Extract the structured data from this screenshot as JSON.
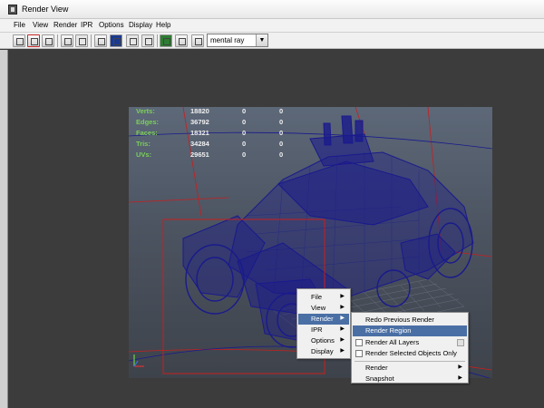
{
  "window": {
    "title": "Render View"
  },
  "menubar": {
    "items": [
      "File",
      "View",
      "Render",
      "IPR",
      "Options",
      "Display",
      "Help"
    ]
  },
  "toolbar": {
    "buttons": [
      "redo-previous-render",
      "render-region",
      "snapshot",
      "ipr-render",
      "refresh-ipr",
      "keep-image",
      "rgb-channels",
      "alpha-channel",
      "real-size",
      "display-options",
      "color-settings",
      "open-image"
    ],
    "renderer": "mental ray"
  },
  "hud": {
    "rows": [
      {
        "label": "Verts:",
        "values": [
          "18820",
          "0",
          "0"
        ]
      },
      {
        "label": "Edges:",
        "values": [
          "36792",
          "0",
          "0"
        ]
      },
      {
        "label": "Faces:",
        "values": [
          "18321",
          "0",
          "0"
        ]
      },
      {
        "label": "Tris:",
        "values": [
          "34284",
          "0",
          "0"
        ]
      },
      {
        "label": "UVs:",
        "values": [
          "29651",
          "0",
          "0"
        ]
      }
    ]
  },
  "context_menu": {
    "items": [
      {
        "label": "File",
        "submenu": true
      },
      {
        "label": "View",
        "submenu": true
      },
      {
        "label": "Render",
        "submenu": true,
        "highlighted": true
      },
      {
        "label": "IPR",
        "submenu": true
      },
      {
        "label": "Options",
        "submenu": true
      },
      {
        "label": "Display",
        "submenu": true
      }
    ]
  },
  "render_submenu": {
    "items": [
      {
        "label": "Redo Previous Render"
      },
      {
        "label": "Render Region",
        "highlighted": true
      },
      {
        "label": "Render All Layers",
        "checkbox": true,
        "checked": false,
        "option_box": true
      },
      {
        "label": "Render Selected Objects Only",
        "checkbox": true,
        "checked": false
      },
      {
        "label": "Render",
        "submenu": true
      },
      {
        "label": "Snapshot",
        "submenu": true
      }
    ]
  },
  "colors": {
    "wireframe": "#1a1a8c",
    "region_marquee": "#c81e1e",
    "hud_label": "#7ccf5a",
    "menu_highlight": "#4a6fa5"
  }
}
